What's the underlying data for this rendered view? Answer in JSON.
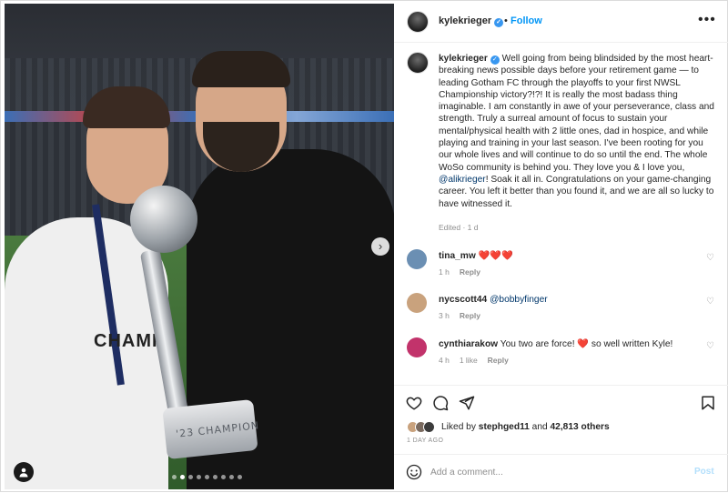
{
  "post_author": {
    "username": "kylekrieger",
    "follow_label": "Follow",
    "separator": "•",
    "more_label": "•••"
  },
  "photo": {
    "shirt_text": "CHAMPI",
    "trophy_text": "'23 CHAMPION",
    "carousel_dots": 9,
    "active_dot": 1
  },
  "caption": {
    "username": "kylekrieger",
    "text_part1": "Well going from being blindsided by the most heart-breaking news possible days before your retirement game — to leading Gotham FC through the playoffs to your first NWSL Championship victory?!?! It is really the most badass thing imaginable. I am constantly in awe of your perseverance, class and strength. Truly a surreal amount of focus to sustain your mental/physical health with 2 little ones, dad in hospice, and while playing and training in your last season. I've been rooting for you our whole lives and will continue to do so until the end. The whole WoSo community is behind you. They love you & I love you, ",
    "mention": "@alikrieger",
    "text_part2": "! Soak it all in. Congratulations on your game-changing career. You left it better than you found it, and we are all so lucky to have witnessed it.",
    "meta": "Edited · 1 d"
  },
  "comments": [
    {
      "username": "tina_mw",
      "text": "",
      "hearts": "❤️❤️❤️",
      "time": "1 h",
      "likes": "",
      "reply": "Reply",
      "avatar_color": "#6b8fb3"
    },
    {
      "username": "nycscott44",
      "text": "",
      "mention": "@bobbyfinger",
      "time": "3 h",
      "likes": "",
      "reply": "Reply",
      "avatar_color": "#c9a27d"
    },
    {
      "username": "cynthiarakow",
      "text": "You two are force! ",
      "heart": "❤️",
      "text_after": " so well written Kyle!",
      "time": "4 h",
      "likes": "1 like",
      "reply": "Reply",
      "avatar_color": "#c2336b"
    }
  ],
  "likes": {
    "prefix": "Liked by ",
    "first_liker": "stephged11",
    "middle": " and ",
    "others": "42,813 others"
  },
  "posted_ago": "1 DAY AGO",
  "add_comment": {
    "placeholder": "Add a comment...",
    "post_label": "Post"
  },
  "colors": {
    "accent": "#0095f6",
    "verified": "#3897f0",
    "heart": "#ed4956",
    "secondary_text": "#8e8e8e"
  },
  "icons": [
    "verified-badge-icon",
    "more-options-icon",
    "heart-icon",
    "comment-icon",
    "share-icon",
    "save-icon",
    "emoji-icon",
    "next-image-icon",
    "user-tag-icon"
  ]
}
